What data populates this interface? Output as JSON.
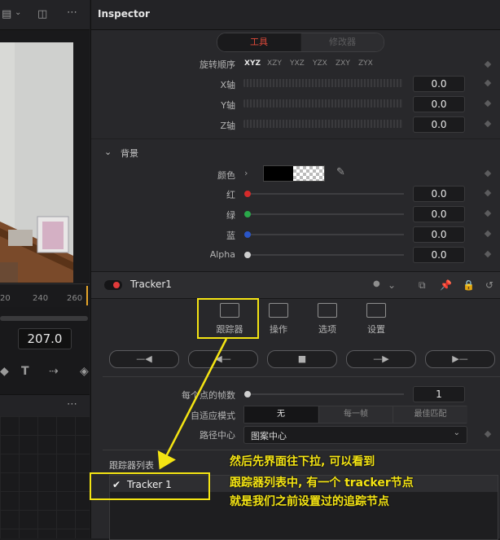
{
  "viewer": {
    "timecode": "207.0",
    "ruler_ticks": [
      "20",
      "240",
      "260"
    ]
  },
  "inspector": {
    "title": "Inspector",
    "tabs": {
      "tools": "工具",
      "modifiers": "修改器"
    },
    "rotation_order": {
      "label": "旋转顺序",
      "options": [
        "XYZ",
        "XZY",
        "YXZ",
        "YZX",
        "ZXY",
        "ZYX"
      ],
      "selected": "XYZ"
    },
    "axes": [
      {
        "label": "X轴",
        "value": "0.0"
      },
      {
        "label": "Y轴",
        "value": "0.0"
      },
      {
        "label": "Z轴",
        "value": "0.0"
      }
    ],
    "background": {
      "section_label": "背景",
      "color_label": "颜色",
      "channels": [
        {
          "label": "红",
          "value": "0.0",
          "color": "#d42a2a"
        },
        {
          "label": "绿",
          "value": "0.0",
          "color": "#2aa84a"
        },
        {
          "label": "蓝",
          "value": "0.0",
          "color": "#2a56c8"
        },
        {
          "label": "Alpha",
          "value": "0.0",
          "color": "#cfcfcf"
        }
      ]
    },
    "node": {
      "name": "Tracker1",
      "tabs": [
        {
          "label": "跟踪器",
          "icon": "tracker-icon"
        },
        {
          "label": "操作",
          "icon": "operation-icon"
        },
        {
          "label": "选项",
          "icon": "options-icon"
        },
        {
          "label": "设置",
          "icon": "settings-icon"
        }
      ]
    },
    "frames_per_point": {
      "label": "每个点的帧数",
      "value": "1"
    },
    "adaptive_mode": {
      "label": "自适应模式",
      "options": [
        "无",
        "每一帧",
        "最佳匹配"
      ],
      "selected": "无"
    },
    "path_center": {
      "label": "路径中心",
      "value": "图案中心"
    },
    "tracker_list": {
      "label": "跟踪器列表",
      "items": [
        {
          "name": "Tracker 1",
          "checked": true
        }
      ]
    }
  },
  "annotation": {
    "lines": [
      "然后先界面往下拉, 可以看到",
      "跟踪器列表中, 有一个 tracker节点",
      "就是我们之前设置过的追踪节点"
    ],
    "color": "#f4e413"
  }
}
